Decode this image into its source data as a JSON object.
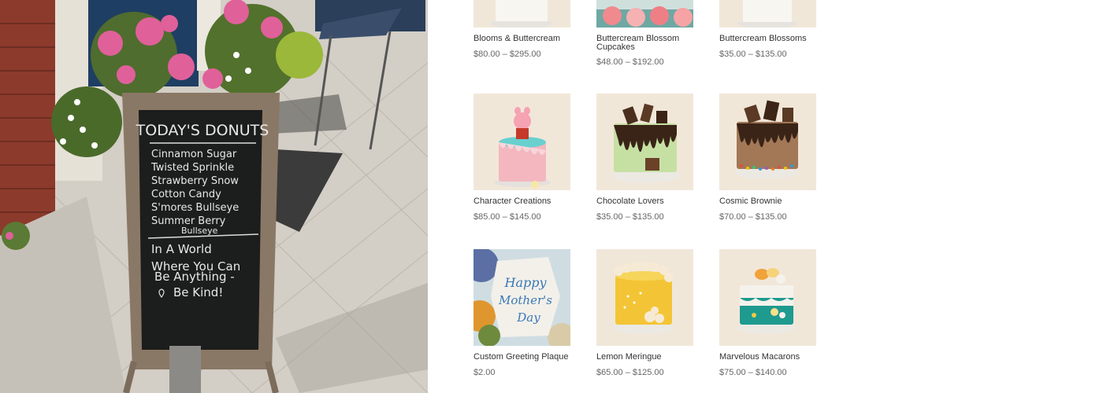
{
  "hero": {
    "sign": {
      "heading": "TODAY'S DONUTS",
      "flavors": [
        "Cinnamon Sugar",
        "Twisted Sprinkle",
        "Strawberry Snow",
        "Cotton Candy",
        "S'mores Bullseye",
        "Summer Berry",
        "Bullseye"
      ],
      "slogan": [
        "In A World",
        "Where You Can",
        "Be Anything -",
        "Be Kind!"
      ]
    }
  },
  "products": [
    {
      "name": "Blooms & Buttercream",
      "price": "$80.00 – $295.00",
      "image": "white-cake-icon"
    },
    {
      "name": "Buttercream Blossom Cupcakes",
      "price": "$48.00 – $192.00",
      "image": "cupcakes-icon"
    },
    {
      "name": "Buttercream Blossoms",
      "price": "$35.00 – $135.00",
      "image": "white-cake-icon"
    },
    {
      "name": "Character Creations",
      "price": "$85.00 – $145.00",
      "image": "character-cake-icon"
    },
    {
      "name": "Chocolate Lovers",
      "price": "$35.00 – $135.00",
      "image": "chocolate-drip-cake-icon"
    },
    {
      "name": "Cosmic Brownie",
      "price": "$70.00 – $135.00",
      "image": "brownie-cake-icon"
    },
    {
      "name": "Custom Greeting Plaque",
      "price": "$2.00",
      "image": "greeting-plaque-icon"
    },
    {
      "name": "Lemon Meringue",
      "price": "$65.00 – $125.00",
      "image": "lemon-cake-icon"
    },
    {
      "name": "Marvelous Macarons",
      "price": "$75.00 – $140.00",
      "image": "macaron-cake-icon"
    }
  ],
  "plaque_text": [
    "Happy",
    "Mother's",
    "Day"
  ],
  "colors": {
    "thumb_background": "#f1e7d9",
    "price_text": "#666666",
    "name_text": "#333333"
  }
}
